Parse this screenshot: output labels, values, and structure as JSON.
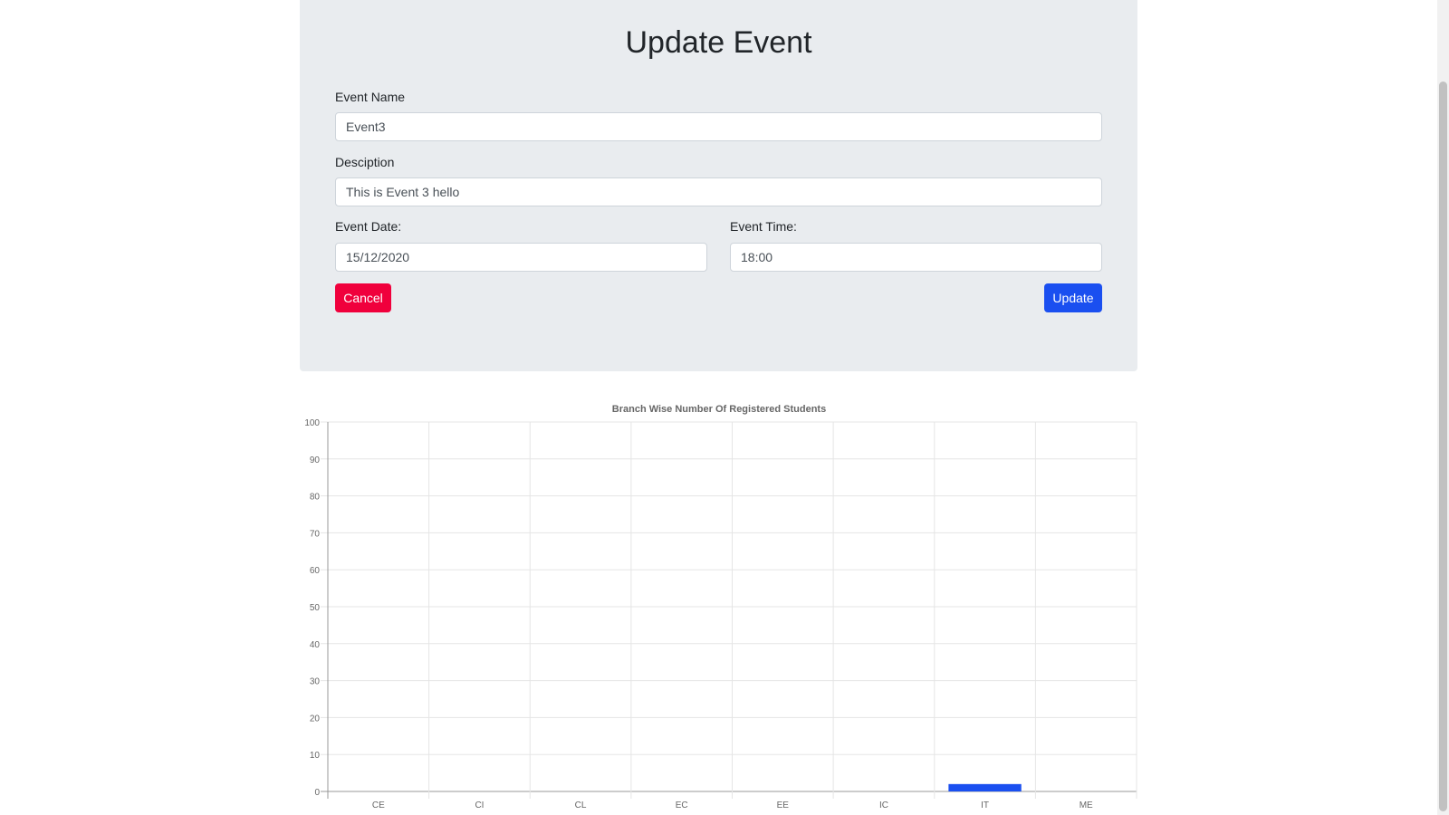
{
  "form": {
    "title": "Update Event",
    "event_name_label": "Event Name",
    "event_name_value": "Event3",
    "description_label": "Desciption",
    "description_value": "This is Event 3 hello",
    "event_date_label": "Event Date:",
    "event_date_value": "15/12/2020",
    "event_time_label": "Event Time:",
    "event_time_value": "18:00",
    "cancel_label": "Cancel",
    "update_label": "Update"
  },
  "colors": {
    "card_bg": "#e9ecef",
    "cancel": "#f0003c",
    "update": "#1a4ff0",
    "bar": "#1a4ff0"
  },
  "chart_data": {
    "type": "bar",
    "title": "Branch Wise Number Of Registered Students",
    "categories": [
      "CE",
      "CI",
      "CL",
      "EC",
      "EE",
      "IC",
      "IT",
      "ME"
    ],
    "values": [
      0,
      0,
      0,
      0,
      0,
      0,
      2,
      0
    ],
    "ylim": [
      0,
      100
    ],
    "yticks": [
      0,
      10,
      20,
      30,
      40,
      50,
      60,
      70,
      80,
      90,
      100
    ],
    "grid": true,
    "legend": "none"
  }
}
